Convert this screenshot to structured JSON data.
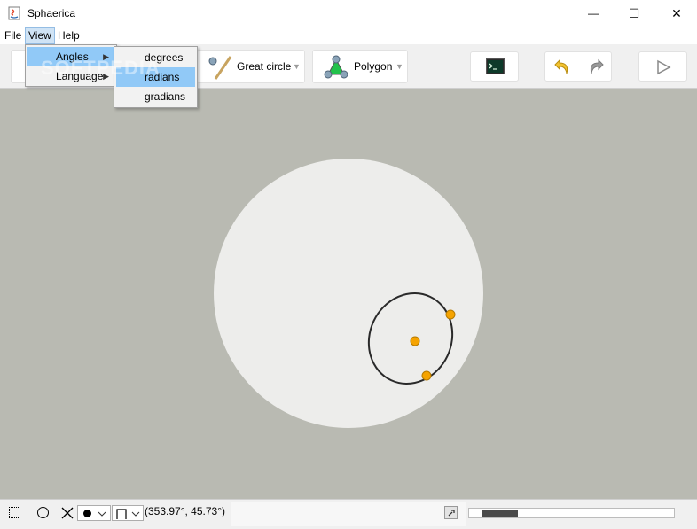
{
  "window": {
    "title": "Sphaerica",
    "controls": {
      "minimize": "—",
      "maximize": "☐",
      "close": "✕"
    }
  },
  "menubar": {
    "items": [
      "File",
      "View",
      "Help"
    ]
  },
  "view_menu": {
    "items": [
      {
        "label": "Angles",
        "has_submenu": true,
        "selected": true
      },
      {
        "label": "Language",
        "has_submenu": true,
        "selected": false
      }
    ]
  },
  "angles_submenu": {
    "items": [
      {
        "label": "degrees",
        "selected": false
      },
      {
        "label": "radians",
        "selected": true
      },
      {
        "label": "gradians",
        "selected": false
      }
    ]
  },
  "toolbar": {
    "great_circle_label": "Great circle",
    "polygon_label": "Polygon",
    "dropdown_arrow": "▼"
  },
  "statusbar": {
    "coordinates": "(353.97°, 45.73°)",
    "progress_fraction": 0.08
  },
  "colors": {
    "canvas": "#b9bab2",
    "sphere": "#ededeb",
    "point": "#f5a300",
    "curve": "#2a2a2a",
    "menu_highlight": "#91c9f7"
  },
  "watermark": "SOFTPEDIA"
}
